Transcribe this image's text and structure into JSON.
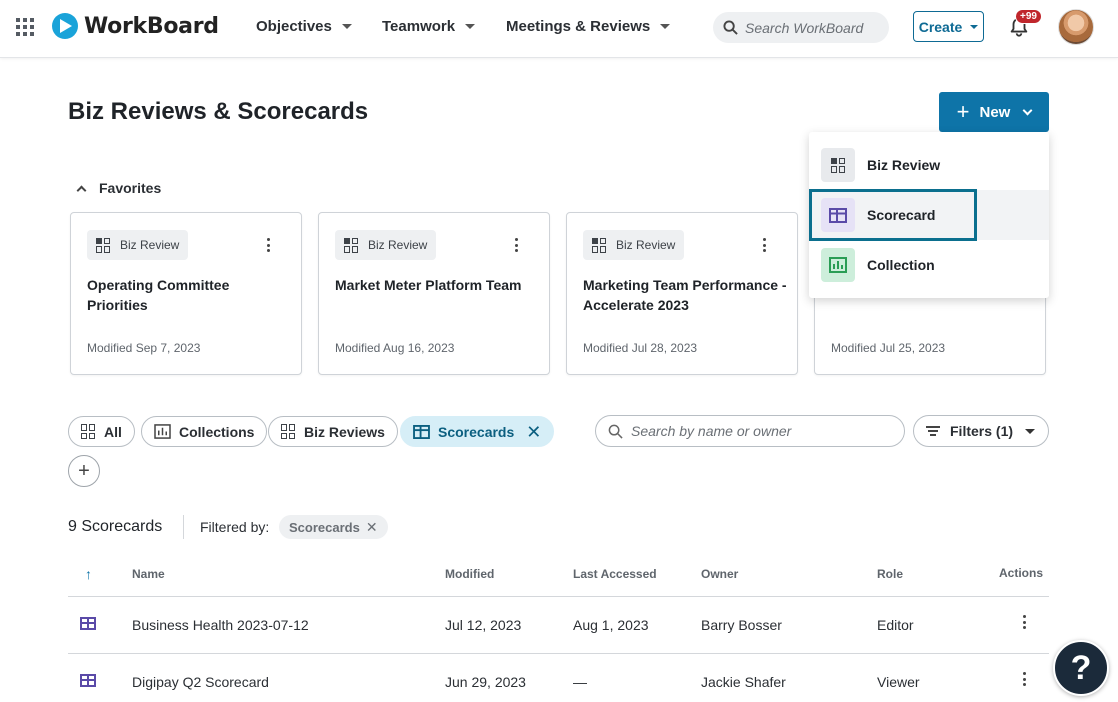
{
  "nav": {
    "logo_text": "WorkBoard",
    "items": [
      {
        "label": "Objectives"
      },
      {
        "label": "Teamwork"
      },
      {
        "label": "Meetings & Reviews"
      }
    ],
    "search_placeholder": "Search WorkBoard",
    "create_label": "Create",
    "notification_badge": "+99"
  },
  "page": {
    "title": "Biz Reviews & Scorecards",
    "new_label": "New"
  },
  "new_menu": {
    "items": [
      {
        "label": "Biz Review",
        "icon": "grid-icon"
      },
      {
        "label": "Scorecard",
        "icon": "table-icon",
        "focused": true
      },
      {
        "label": "Collection",
        "icon": "chart-icon"
      }
    ]
  },
  "favorites": {
    "label": "Favorites",
    "cards": [
      {
        "type": "Biz Review",
        "title": "Operating Committee Priorities",
        "modified": "Modified Sep 7, 2023"
      },
      {
        "type": "Biz Review",
        "title": "Market Meter Platform Team",
        "modified": "Modified Aug 16, 2023"
      },
      {
        "type": "Biz Review",
        "title": "Marketing Team Performance - Accelerate 2023",
        "modified": "Modified Jul 28, 2023"
      },
      {
        "type": "",
        "title": "",
        "modified": "Modified Jul 25, 2023"
      }
    ]
  },
  "filters": {
    "chips": [
      {
        "label": "All"
      },
      {
        "label": "Collections"
      },
      {
        "label": "Biz Reviews"
      },
      {
        "label": "Scorecards",
        "active": true
      }
    ],
    "search_placeholder": "Search by name or owner",
    "filters_label": "Filters (1)"
  },
  "results": {
    "count_label": "9 Scorecards",
    "filtered_by_label": "Filtered by:",
    "filtered_by_chip": "Scorecards"
  },
  "table": {
    "columns": [
      "Name",
      "Modified",
      "Last Accessed",
      "Owner",
      "Role",
      "Actions"
    ],
    "rows": [
      {
        "name": "Business Health 2023-07-12",
        "modified": "Jul 12, 2023",
        "last_accessed": "Aug 1, 2023",
        "owner": "Barry Bosser",
        "role": "Editor"
      },
      {
        "name": "Digipay Q2 Scorecard",
        "modified": "Jun 29, 2023",
        "last_accessed": "—",
        "owner": "Jackie Shafer",
        "role": "Viewer"
      }
    ]
  },
  "help_label": "?",
  "colors": {
    "primary": "#0e74a8",
    "scorecard_icon": "#5a4aa8",
    "collection_icon": "#2a9d55",
    "focus_ring": "#0b6f8e"
  }
}
